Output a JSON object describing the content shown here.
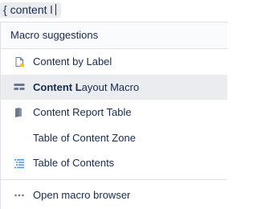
{
  "query": {
    "text": "{ content l"
  },
  "menu": {
    "header": "Macro suggestions",
    "items": [
      {
        "label_bold": "",
        "label_rest": "Content by Label",
        "icon": "page-label-icon",
        "active": false
      },
      {
        "label_bold": "Content L",
        "label_rest": "ayout Macro",
        "icon": "layout-icon",
        "active": true
      },
      {
        "label_bold": "",
        "label_rest": "Content Report Table",
        "icon": "report-icon",
        "active": false
      },
      {
        "label_bold": "",
        "label_rest": "Table of Content Zone",
        "icon": "",
        "active": false
      },
      {
        "label_bold": "",
        "label_rest": "Table of Contents",
        "icon": "toc-icon",
        "active": false
      }
    ],
    "footer": {
      "label": "Open macro browser",
      "icon": "ellipsis-icon"
    }
  },
  "colors": {
    "accent_blue": "#4c9aff",
    "icon_gray": "#6b778c",
    "active_bg": "#ebecf0",
    "label_yellow": "#ffc400"
  }
}
